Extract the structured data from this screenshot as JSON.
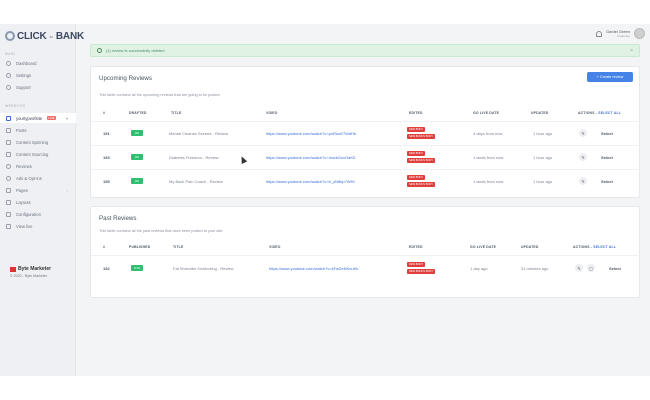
{
  "app": {
    "logo_text": "CLICK",
    "logo_sub": "to",
    "logo_text2": "BANK"
  },
  "sidebar": {
    "section_main": "MAIN",
    "items_main": [
      {
        "label": "Dashboard",
        "icon": "dashboard-icon"
      },
      {
        "label": "Settings",
        "icon": "gear-icon"
      },
      {
        "label": "Support",
        "icon": "help-icon"
      }
    ],
    "section_websites": "WEBSITES",
    "site": {
      "label": "yourtypeofsite",
      "tag": "LIVE"
    },
    "items_site": [
      {
        "label": "Posts",
        "icon": "document-icon"
      },
      {
        "label": "Content Spinning",
        "icon": "spin-icon"
      },
      {
        "label": "Content Sourcing",
        "icon": "source-icon"
      },
      {
        "label": "Reviews",
        "icon": "review-icon"
      },
      {
        "label": "Ads & Opt-ins",
        "icon": "ads-icon"
      },
      {
        "label": "Pages",
        "icon": "pages-icon"
      },
      {
        "label": "Layouts",
        "icon": "layout-icon"
      },
      {
        "label": "Configuration",
        "icon": "config-icon"
      },
      {
        "label": "View live",
        "icon": "external-icon"
      }
    ],
    "brand_name": "Byte Marketer",
    "brand_copy": "© 2020 - Byte Marketer"
  },
  "header": {
    "user_name": "Daniel Green",
    "user_role": "Customer"
  },
  "alert": {
    "text": "(1) review is successfully deleted"
  },
  "upcoming": {
    "title": "Upcoming Reviews",
    "subtitle": "This table contains all the upcoming reviews that are going to be posted.",
    "create_label": "+ Create review",
    "headers": {
      "id": "#",
      "status": "DRAFTED",
      "title": "TITLE",
      "video": "VIDEO",
      "edited": "EDITED",
      "golive": "GO LIVE DATE",
      "updated": "UPDATED",
      "actions": "ACTIONS - ",
      "select_all": "SELECT ALL"
    },
    "rows": [
      {
        "id": "151",
        "status": "OK",
        "title": "Mental Cleanse Secrets - Review",
        "video": "https://www.youtube.com/watch?v=pnRuuE7WdHk",
        "edited": [
          "NEW BODY",
          "NEW BONUS BODY"
        ],
        "golive": "4 days from now",
        "updated": "1 hour ago",
        "select": "Select"
      },
      {
        "id": "153",
        "status": "OK",
        "title": "Diabetes Freedom - Review",
        "video": "https://www.youtube.com/watch?v=4cwkGoxOaKE",
        "edited": [
          "NEW BODY",
          "NEW BONUS BODY"
        ],
        "golive": "1 week from now",
        "updated": "1 hour ago",
        "select": "Select"
      },
      {
        "id": "155",
        "status": "OK",
        "title": "My Back Pain Coach - Review",
        "video": "https://www.youtube.com/watch?v=b_yN8bp7WHI",
        "edited": [
          "NEW BODY",
          "NEW BONUS BODY"
        ],
        "golive": "1 week from now",
        "updated": "1 hour ago",
        "select": "Select"
      }
    ]
  },
  "past": {
    "title": "Past Reviews",
    "subtitle": "This table contains all the past reviews that have been posted to your site.",
    "headers": {
      "id": "#",
      "status": "PUBLISHED",
      "title": "TITLE",
      "video": "VIDEO",
      "edited": "EDITED",
      "golive": "GO LIVE DATE",
      "updated": "UPDATED",
      "actions": "ACTIONS - ",
      "select_all": "SELECT ALL"
    },
    "rows": [
      {
        "id": "152",
        "status": "LIVE",
        "title": "Fat Shredder Kickboxing - Review",
        "video": "https://www.youtube.com/watch?v=kFwZeNKnuKk",
        "edited": [
          "NEW BODY",
          "NEW BONUS BODY"
        ],
        "golive": "1 day ago",
        "updated": "31 minutes ago",
        "select": "Select"
      }
    ]
  }
}
